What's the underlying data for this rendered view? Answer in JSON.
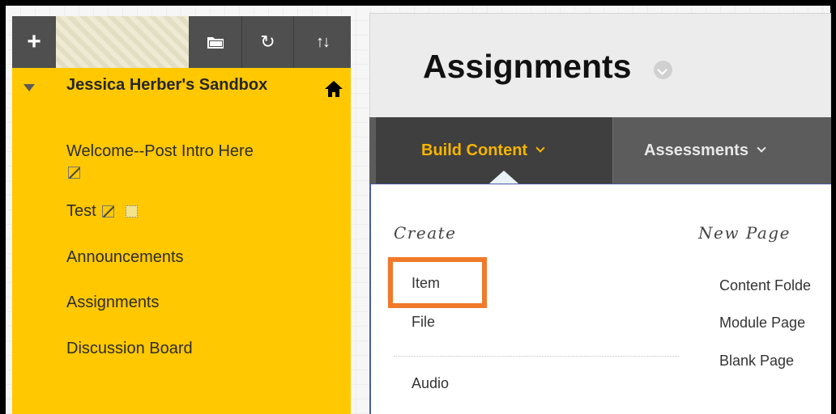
{
  "colors": {
    "sidebar_bg": "#ffc800",
    "toolbar_bg": "#4f4f4f",
    "active_tab_text": "#f6b400",
    "highlight_border": "#f07a2a"
  },
  "toolbar": {
    "add_icon": "plus-icon",
    "folder_icon": "folder-icon",
    "refresh_icon": "refresh-icon",
    "sort_icon": "sort-icon"
  },
  "sidebar": {
    "course_title": "Jessica Herber's Sandbox",
    "items": [
      {
        "label": "Welcome--Post Intro Here"
      },
      {
        "label": "Test"
      },
      {
        "label": "Announcements"
      },
      {
        "label": "Assignments"
      },
      {
        "label": "Discussion Board"
      }
    ]
  },
  "header": {
    "title": "Assignments"
  },
  "tabs": [
    {
      "label": "Build Content"
    },
    {
      "label": "Assessments"
    }
  ],
  "dropdown": {
    "create_heading": "Create",
    "new_page_heading": "New Page",
    "create_items": [
      "Item",
      "File",
      "Audio"
    ],
    "new_page_items": [
      "Content Folde",
      "Module Page",
      "Blank Page"
    ]
  }
}
